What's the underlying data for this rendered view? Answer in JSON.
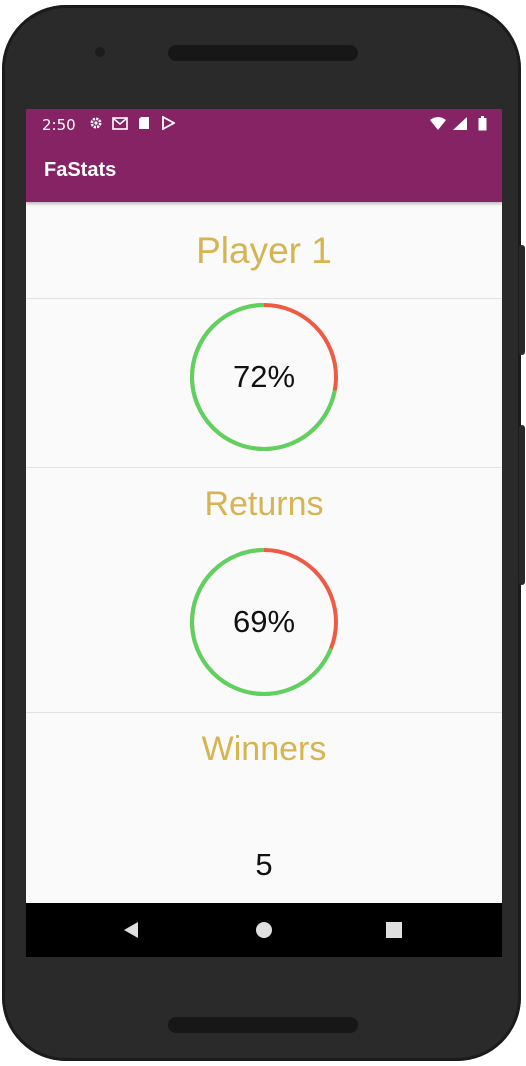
{
  "status_bar": {
    "time": "2:50",
    "left_icons": [
      "gear-icon",
      "gmail-icon",
      "sd-card-icon",
      "play-store-icon"
    ],
    "right_icons": [
      "wifi-icon",
      "signal-icon",
      "battery-icon"
    ]
  },
  "app_bar": {
    "title": "FaStats",
    "color": "#862365"
  },
  "player": {
    "name": "Player 1"
  },
  "stats": [
    {
      "gauge_label": "72%",
      "percent": 72,
      "title": "Returns"
    },
    {
      "gauge_label": "69%",
      "percent": 69,
      "title": "Winners"
    }
  ],
  "winners_value": "5",
  "colors": {
    "gauge_fill": "#5dd35f",
    "gauge_remainder": "#ef5a45",
    "accent_text": "#d6b451"
  },
  "nav_bar": {
    "buttons": [
      "back-icon",
      "home-icon",
      "recents-icon"
    ]
  }
}
